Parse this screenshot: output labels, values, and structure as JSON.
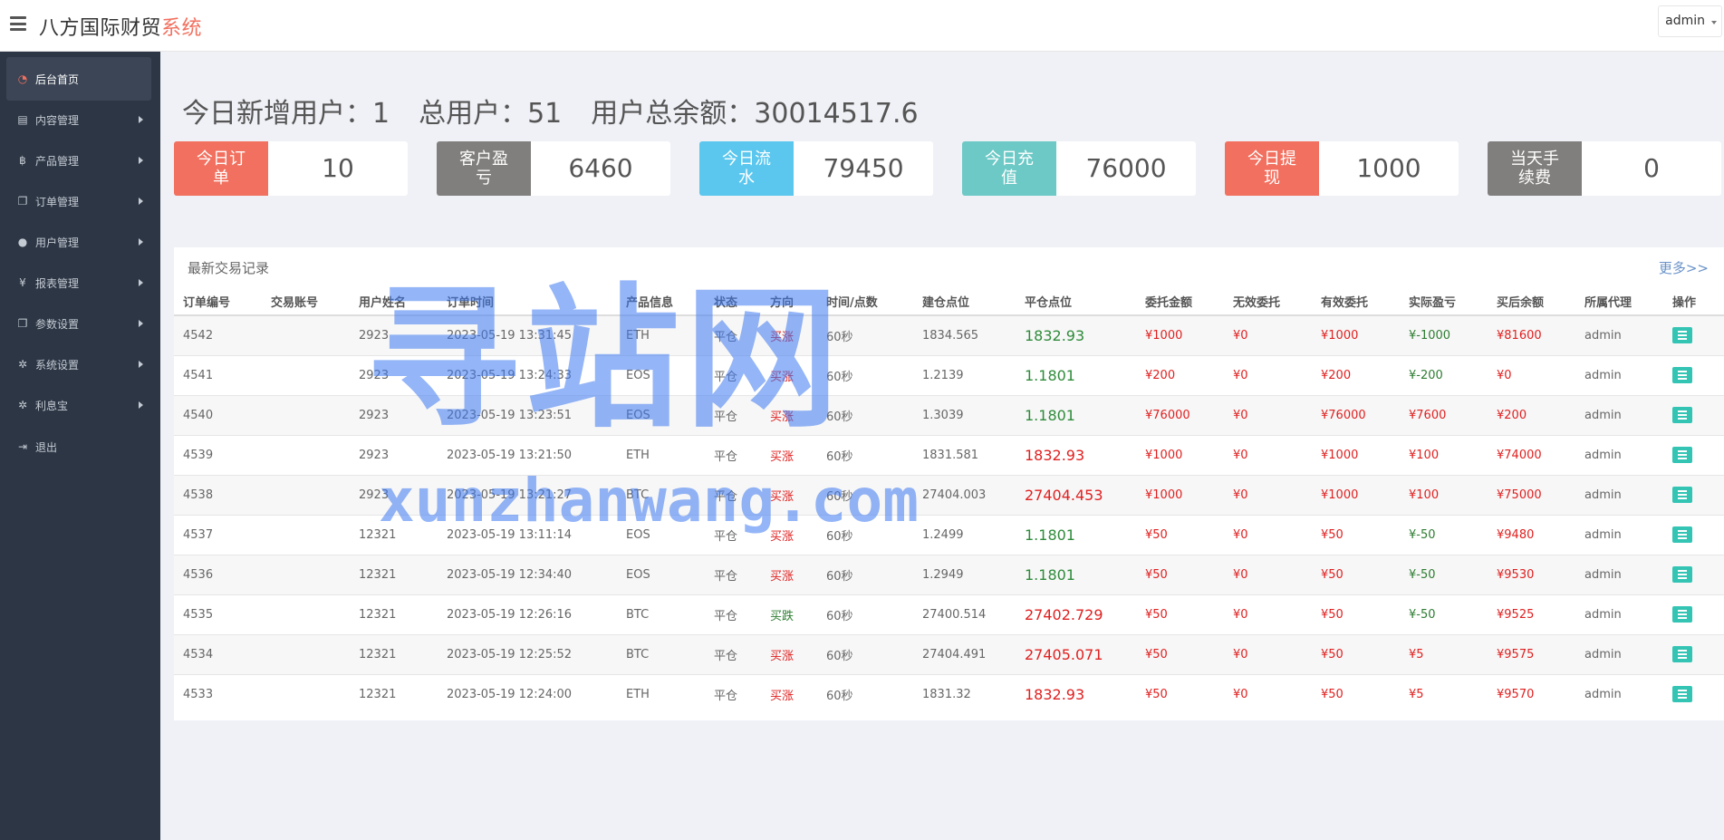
{
  "header": {
    "brand_main": "八方国际财贸",
    "brand_accent": "系统",
    "user": "admin"
  },
  "sidebar": {
    "items": [
      {
        "label": "后台首页",
        "icon": "dashboard-icon"
      },
      {
        "label": "内容管理",
        "icon": "book-icon"
      },
      {
        "label": "产品管理",
        "icon": "bitcoin-icon"
      },
      {
        "label": "订单管理",
        "icon": "copy-icon"
      },
      {
        "label": "用户管理",
        "icon": "user-icon"
      },
      {
        "label": "报表管理",
        "icon": "yen-icon"
      },
      {
        "label": "参数设置",
        "icon": "copy-icon"
      },
      {
        "label": "系统设置",
        "icon": "gears-icon"
      },
      {
        "label": "利息宝",
        "icon": "gears-icon"
      },
      {
        "label": "退出",
        "icon": "sign-out-icon"
      }
    ]
  },
  "summary": {
    "new_users": "今日新增用户：1",
    "total_users": "总用户：51",
    "total_balance": "用户总余额：30014517.6"
  },
  "stats": [
    {
      "label": "今日订单",
      "value": "10",
      "color": "#f2705f"
    },
    {
      "label": "客户盈亏",
      "value": "6460",
      "color": "#817f7d"
    },
    {
      "label": "今日流水",
      "value": "79450",
      "color": "#5bc7ee"
    },
    {
      "label": "今日充值",
      "value": "76000",
      "color": "#6cc9c6"
    },
    {
      "label": "今日提现",
      "value": "1000",
      "color": "#f2705f"
    },
    {
      "label": "当天手续费",
      "value": "0",
      "color": "#817f7d"
    }
  ],
  "table": {
    "title": "最新交易记录",
    "more": "更多>>",
    "columns": [
      "订单编号",
      "交易账号",
      "用户姓名",
      "订单时间",
      "产品信息",
      "状态",
      "方向",
      "时间/点数",
      "建仓点位",
      "平仓点位",
      "委托金额",
      "无效委托",
      "有效委托",
      "实际盈亏",
      "买后余额",
      "所属代理",
      "操作"
    ],
    "rows": [
      {
        "id": "4542",
        "account": "",
        "name": "2923",
        "time": "2023-05-19 13:31:45",
        "product": "ETH",
        "status": "平仓",
        "direction": "买涨",
        "period": "60秒",
        "open": "1834.565",
        "close": "1832.93",
        "amount": "¥1000",
        "invalid": "¥0",
        "valid": "¥1000",
        "pnl": "¥-1000",
        "balance": "¥81600",
        "agent": "admin"
      },
      {
        "id": "4541",
        "account": "",
        "name": "2923",
        "time": "2023-05-19 13:24:33",
        "product": "EOS",
        "status": "平仓",
        "direction": "买涨",
        "period": "60秒",
        "open": "1.2139",
        "close": "1.1801",
        "amount": "¥200",
        "invalid": "¥0",
        "valid": "¥200",
        "pnl": "¥-200",
        "balance": "¥0",
        "agent": "admin"
      },
      {
        "id": "4540",
        "account": "",
        "name": "2923",
        "time": "2023-05-19 13:23:51",
        "product": "EOS",
        "status": "平仓",
        "direction": "买涨",
        "period": "60秒",
        "open": "1.3039",
        "close": "1.1801",
        "amount": "¥76000",
        "invalid": "¥0",
        "valid": "¥76000",
        "pnl": "¥7600",
        "balance": "¥200",
        "agent": "admin"
      },
      {
        "id": "4539",
        "account": "",
        "name": "2923",
        "time": "2023-05-19 13:21:50",
        "product": "ETH",
        "status": "平仓",
        "direction": "买涨",
        "period": "60秒",
        "open": "1831.581",
        "close": "1832.93",
        "amount": "¥1000",
        "invalid": "¥0",
        "valid": "¥1000",
        "pnl": "¥100",
        "balance": "¥74000",
        "agent": "admin"
      },
      {
        "id": "4538",
        "account": "",
        "name": "2923",
        "time": "2023-05-19 13:21:27",
        "product": "BTC",
        "status": "平仓",
        "direction": "买涨",
        "period": "60秒",
        "open": "27404.003",
        "close": "27404.453",
        "amount": "¥1000",
        "invalid": "¥0",
        "valid": "¥1000",
        "pnl": "¥100",
        "balance": "¥75000",
        "agent": "admin"
      },
      {
        "id": "4537",
        "account": "",
        "name": "12321",
        "time": "2023-05-19 13:11:14",
        "product": "EOS",
        "status": "平仓",
        "direction": "买涨",
        "period": "60秒",
        "open": "1.2499",
        "close": "1.1801",
        "amount": "¥50",
        "invalid": "¥0",
        "valid": "¥50",
        "pnl": "¥-50",
        "balance": "¥9480",
        "agent": "admin"
      },
      {
        "id": "4536",
        "account": "",
        "name": "12321",
        "time": "2023-05-19 12:34:40",
        "product": "EOS",
        "status": "平仓",
        "direction": "买涨",
        "period": "60秒",
        "open": "1.2949",
        "close": "1.1801",
        "amount": "¥50",
        "invalid": "¥0",
        "valid": "¥50",
        "pnl": "¥-50",
        "balance": "¥9530",
        "agent": "admin"
      },
      {
        "id": "4535",
        "account": "",
        "name": "12321",
        "time": "2023-05-19 12:26:16",
        "product": "BTC",
        "status": "平仓",
        "direction": "买跌",
        "period": "60秒",
        "open": "27400.514",
        "close": "27402.729",
        "amount": "¥50",
        "invalid": "¥0",
        "valid": "¥50",
        "pnl": "¥-50",
        "balance": "¥9525",
        "agent": "admin"
      },
      {
        "id": "4534",
        "account": "",
        "name": "12321",
        "time": "2023-05-19 12:25:52",
        "product": "BTC",
        "status": "平仓",
        "direction": "买涨",
        "period": "60秒",
        "open": "27404.491",
        "close": "27405.071",
        "amount": "¥50",
        "invalid": "¥0",
        "valid": "¥50",
        "pnl": "¥5",
        "balance": "¥9575",
        "agent": "admin"
      },
      {
        "id": "4533",
        "account": "",
        "name": "12321",
        "time": "2023-05-19 12:24:00",
        "product": "ETH",
        "status": "平仓",
        "direction": "买涨",
        "period": "60秒",
        "open": "1831.32",
        "close": "1832.93",
        "amount": "¥50",
        "invalid": "¥0",
        "valid": "¥50",
        "pnl": "¥5",
        "balance": "¥9570",
        "agent": "admin"
      }
    ]
  },
  "watermark": {
    "line1": "寻站网",
    "line2": "xunzhanwang.com"
  }
}
